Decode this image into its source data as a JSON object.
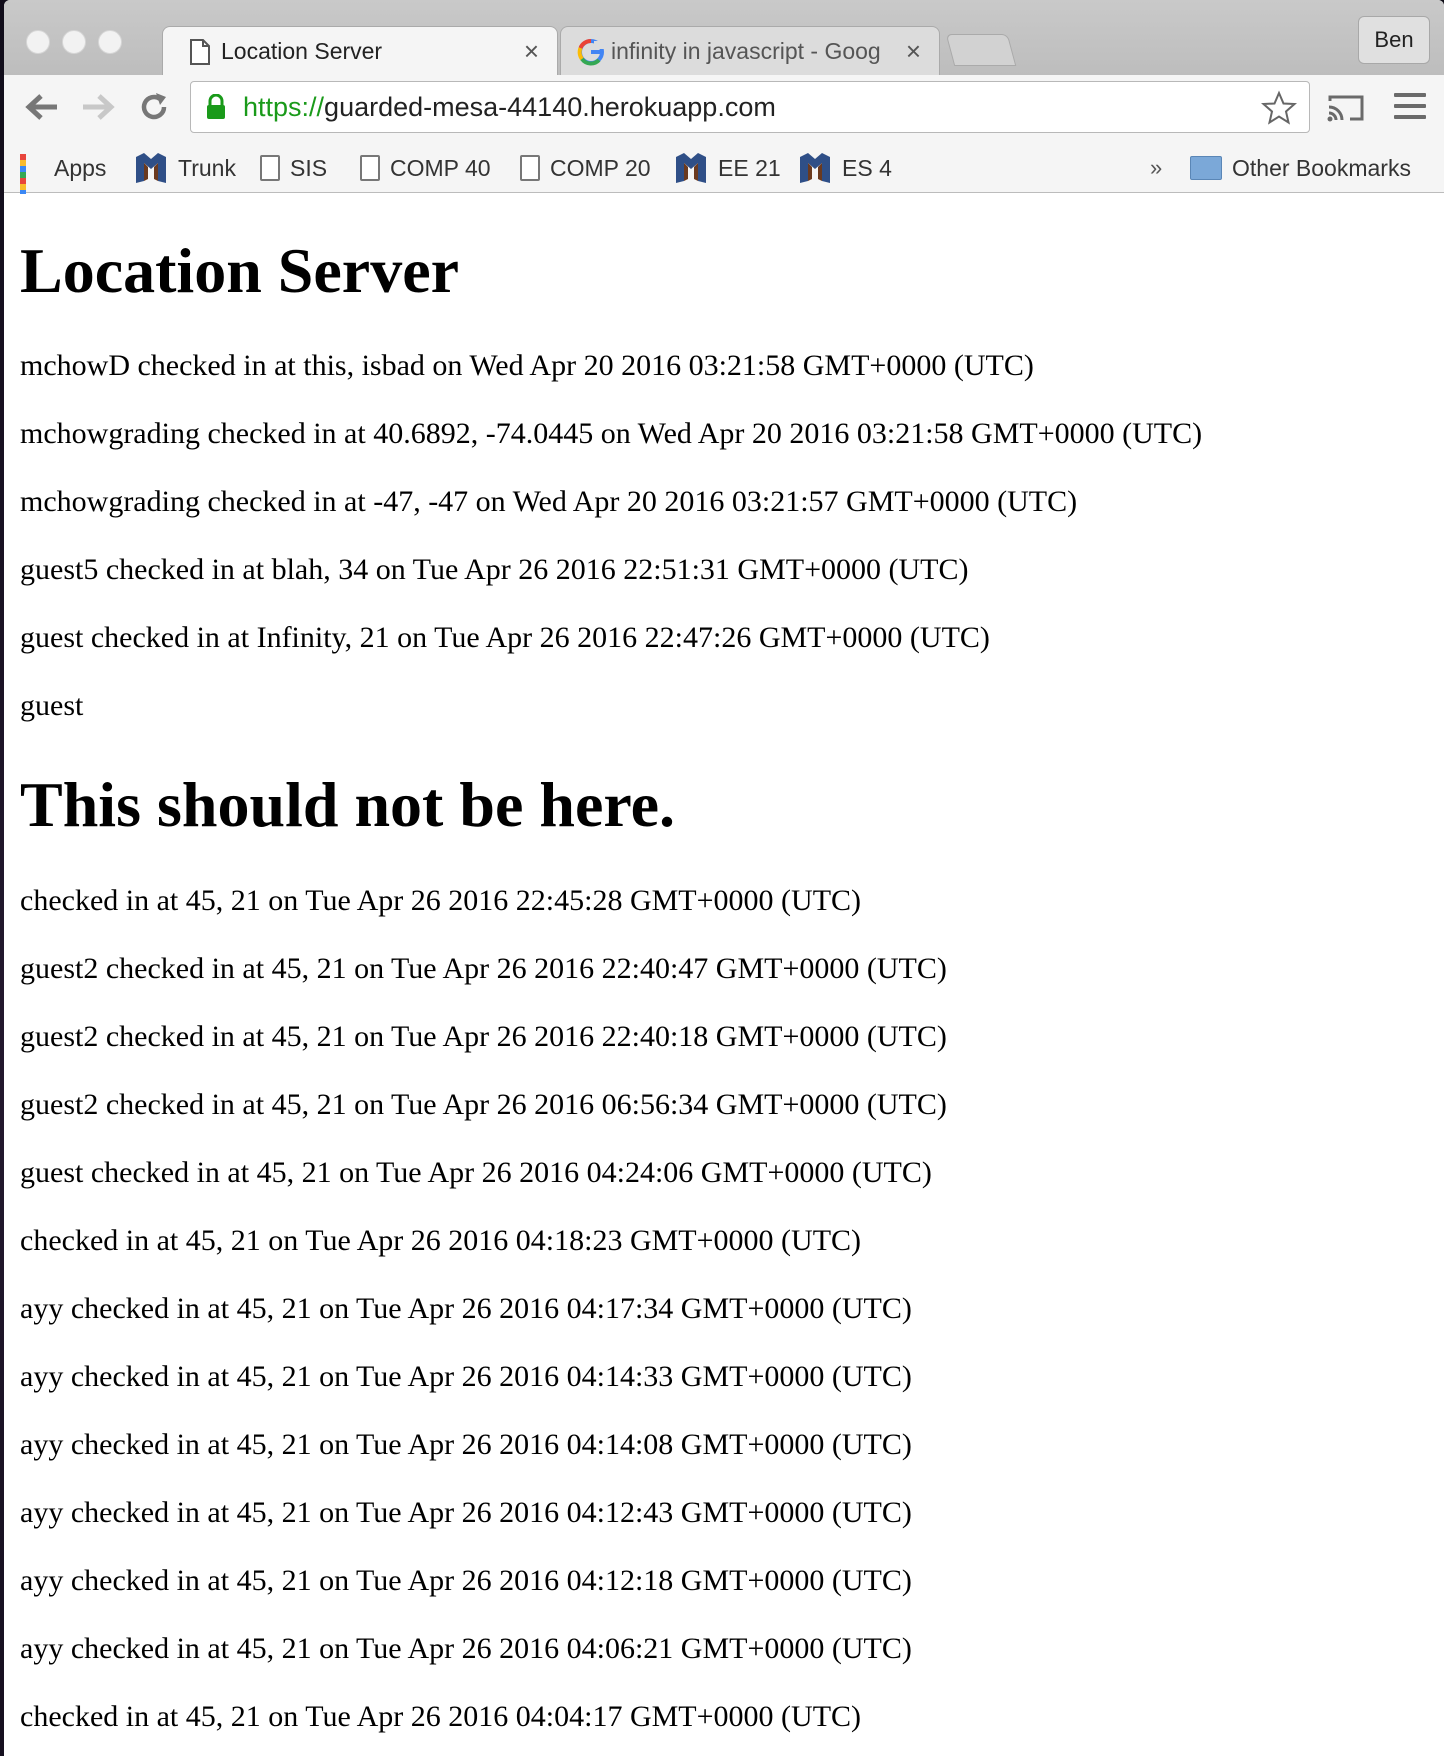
{
  "browser": {
    "tabs": [
      {
        "title": "Location Server",
        "close": "×"
      },
      {
        "title": "infinity in javascript - Goog",
        "close": "×"
      }
    ],
    "profile_name": "Ben",
    "url_scheme": "https://",
    "url_host": "guarded-mesa-44140.herokuapp.com",
    "bookmarks": [
      {
        "label": "Apps",
        "icon": "apps-grid-icon"
      },
      {
        "label": "Trunk",
        "icon": "tufts-logo-icon"
      },
      {
        "label": "SIS",
        "icon": "page-icon"
      },
      {
        "label": "COMP 40",
        "icon": "page-icon"
      },
      {
        "label": "COMP 20",
        "icon": "page-icon"
      },
      {
        "label": "EE 21",
        "icon": "tufts-logo-icon"
      },
      {
        "label": "ES 4",
        "icon": "tufts-logo-icon"
      }
    ],
    "bookmarks_overflow": "»",
    "other_bookmarks": "Other Bookmarks",
    "accent_green": "#1a9a1a"
  },
  "page": {
    "title": "Location Server",
    "entries_before": [
      "mchowD checked in at this, isbad on Wed Apr 20 2016 03:21:58 GMT+0000 (UTC)",
      "mchowgrading checked in at 40.6892, -74.0445 on Wed Apr 20 2016 03:21:58 GMT+0000 (UTC)",
      "mchowgrading checked in at -47, -47 on Wed Apr 20 2016 03:21:57 GMT+0000 (UTC)",
      "guest5 checked in at blah, 34 on Tue Apr 26 2016 22:51:31 GMT+0000 (UTC)",
      "guest checked in at Infinity, 21 on Tue Apr 26 2016 22:47:26 GMT+0000 (UTC)",
      "guest"
    ],
    "injected_heading": "This should not be here.",
    "entries_after": [
      "checked in at 45, 21 on Tue Apr 26 2016 22:45:28 GMT+0000 (UTC)",
      "guest2 checked in at 45, 21 on Tue Apr 26 2016 22:40:47 GMT+0000 (UTC)",
      "guest2 checked in at 45, 21 on Tue Apr 26 2016 22:40:18 GMT+0000 (UTC)",
      "guest2 checked in at 45, 21 on Tue Apr 26 2016 06:56:34 GMT+0000 (UTC)",
      "guest checked in at 45, 21 on Tue Apr 26 2016 04:24:06 GMT+0000 (UTC)",
      "checked in at 45, 21 on Tue Apr 26 2016 04:18:23 GMT+0000 (UTC)",
      "ayy checked in at 45, 21 on Tue Apr 26 2016 04:17:34 GMT+0000 (UTC)",
      "ayy checked in at 45, 21 on Tue Apr 26 2016 04:14:33 GMT+0000 (UTC)",
      "ayy checked in at 45, 21 on Tue Apr 26 2016 04:14:08 GMT+0000 (UTC)",
      "ayy checked in at 45, 21 on Tue Apr 26 2016 04:12:43 GMT+0000 (UTC)",
      "ayy checked in at 45, 21 on Tue Apr 26 2016 04:12:18 GMT+0000 (UTC)",
      "ayy checked in at 45, 21 on Tue Apr 26 2016 04:06:21 GMT+0000 (UTC)",
      "checked in at 45, 21 on Tue Apr 26 2016 04:04:17 GMT+0000 (UTC)"
    ]
  }
}
